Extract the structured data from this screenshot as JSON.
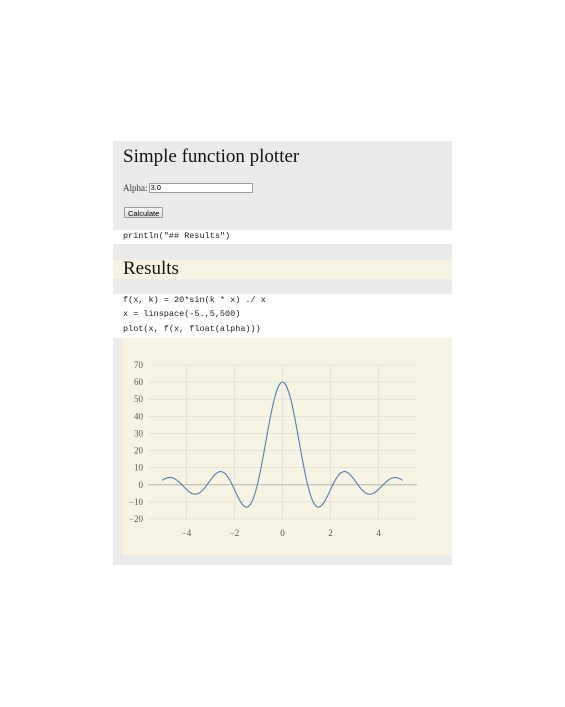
{
  "header": {
    "title": "Simple function plotter"
  },
  "form": {
    "alpha_label": "Alpha:",
    "alpha_value": "3.0",
    "calculate_label": "Calculate"
  },
  "code": {
    "println_line": "println(\"## Results\")",
    "define_line": "f(x, k) = 20*sin(k * x) ./ x",
    "linspace_line": "x = linspace(-5.,5,500)",
    "plot_line": "plot(x, f(x, float(alpha)))"
  },
  "results": {
    "title": "Results"
  },
  "colors": {
    "series": "#4e7fb0",
    "plot_background": "#f8f4e3",
    "grid": "#d9d9d9",
    "page_background": "#ebebeb"
  },
  "chart_data": {
    "type": "line",
    "title": "",
    "xlabel": "",
    "ylabel": "",
    "xlim": [
      -5.6,
      5.6
    ],
    "ylim": [
      -20,
      70
    ],
    "xticks": [
      -4,
      -2,
      0,
      2,
      4
    ],
    "xtick_labels": [
      "−4",
      "−2",
      "0",
      "2",
      "4"
    ],
    "yticks": [
      70,
      60,
      50,
      40,
      30,
      20,
      10,
      0,
      -10,
      -20
    ],
    "ytick_labels": [
      "70",
      "60",
      "50",
      "40",
      "30",
      "20",
      "10",
      "0",
      "−10",
      "−20"
    ],
    "grid": true,
    "series": [
      {
        "function": "20*sin(3.0*x)/x",
        "x_range": [
          -5,
          5
        ],
        "samples": 500,
        "x": [
          -5,
          -4.5,
          -4,
          -3.5,
          -3,
          -2.5,
          -2,
          -1.5,
          -1,
          -0.5,
          0,
          0.5,
          1,
          1.5,
          2,
          2.5,
          3,
          3.5,
          4,
          4.5,
          5
        ],
        "y": [
          2.6,
          3.7,
          2.7,
          -5.0,
          -2.7,
          7.5,
          2.8,
          -13.0,
          2.8,
          39.9,
          60,
          39.9,
          2.8,
          -13.0,
          2.8,
          7.5,
          -2.7,
          -5.0,
          2.7,
          3.7,
          2.6
        ]
      }
    ]
  }
}
